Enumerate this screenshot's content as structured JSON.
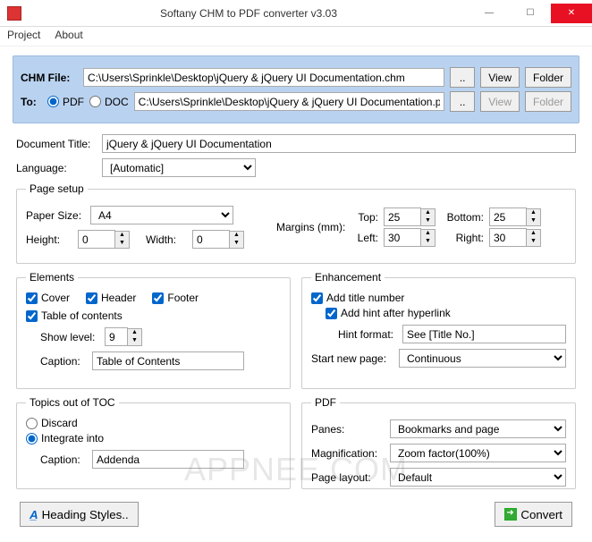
{
  "title": "Softany CHM to PDF converter v3.03",
  "menu": {
    "project": "Project",
    "about": "About"
  },
  "filebox": {
    "chm_label": "CHM File:",
    "chm_path": "C:\\Users\\Sprinkle\\Desktop\\jQuery & jQuery UI Documentation.chm",
    "to_label": "To:",
    "fmt_pdf": "PDF",
    "fmt_doc": "DOC",
    "out_path": "C:\\Users\\Sprinkle\\Desktop\\jQuery & jQuery UI Documentation.pdf",
    "browse": "..",
    "view": "View",
    "folder": "Folder"
  },
  "doc": {
    "title_label": "Document Title:",
    "title_value": "jQuery & jQuery UI Documentation",
    "lang_label": "Language:",
    "lang_value": "[Automatic]"
  },
  "page": {
    "legend": "Page setup",
    "paper_label": "Paper Size:",
    "paper_value": "A4",
    "height_label": "Height:",
    "height_value": "0",
    "width_label": "Width:",
    "width_value": "0",
    "margins_label": "Margins (mm):",
    "top": "Top:",
    "top_v": "25",
    "bottom": "Bottom:",
    "bottom_v": "25",
    "left": "Left:",
    "left_v": "30",
    "right": "Right:",
    "right_v": "30"
  },
  "elements": {
    "legend": "Elements",
    "cover": "Cover",
    "header": "Header",
    "footer": "Footer",
    "toc": "Table of contents",
    "show_level_label": "Show level:",
    "show_level_value": "9",
    "caption_label": "Caption:",
    "caption_value": "Table of Contents"
  },
  "enh": {
    "legend": "Enhancement",
    "add_title_no": "Add title number",
    "add_hint": "Add hint after hyperlink",
    "hint_fmt_label": "Hint format:",
    "hint_fmt_value": "See [Title No.]",
    "newpage_label": "Start new page:",
    "newpage_value": "Continuous"
  },
  "topics": {
    "legend": "Topics out of TOC",
    "discard": "Discard",
    "integrate": "Integrate into",
    "caption_label": "Caption:",
    "caption_value": "Addenda"
  },
  "pdf": {
    "legend": "PDF",
    "panes_label": "Panes:",
    "panes_value": "Bookmarks and page",
    "mag_label": "Magnification:",
    "mag_value": "Zoom factor(100%)",
    "layout_label": "Page layout:",
    "layout_value": "Default"
  },
  "footer": {
    "heading": "Heading Styles..",
    "convert": "Convert"
  },
  "watermark": "APPNEE.COM"
}
